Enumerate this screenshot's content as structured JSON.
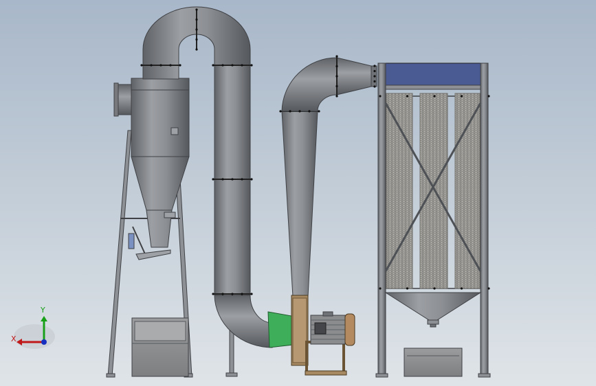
{
  "view_triad": {
    "x_label": "X",
    "y_label": "Y",
    "x_color": "#c01818",
    "y_color": "#18a018",
    "z_color": "#1830c0"
  },
  "colors": {
    "steel": "#8f9296",
    "steel_dark": "#55585c",
    "filter_top": "#4a5a92",
    "inlet_ring": "#3fae5a",
    "fan_housing": "#a88a62",
    "motor": "#8a8c8e",
    "motor_cap": "#b48a60"
  },
  "components": [
    "cyclone-separator",
    "cyclone-support-frame",
    "cyclone-collection-bin",
    "u-bend-duct",
    "vertical-riser-duct",
    "elbow-duct-to-fan",
    "centrifugal-fan",
    "fan-motor",
    "fan-outlet-transition-duct",
    "curved-duct-to-filter",
    "bag-filter-housing",
    "filter-bags",
    "filter-hopper",
    "filter-collection-bin"
  ]
}
